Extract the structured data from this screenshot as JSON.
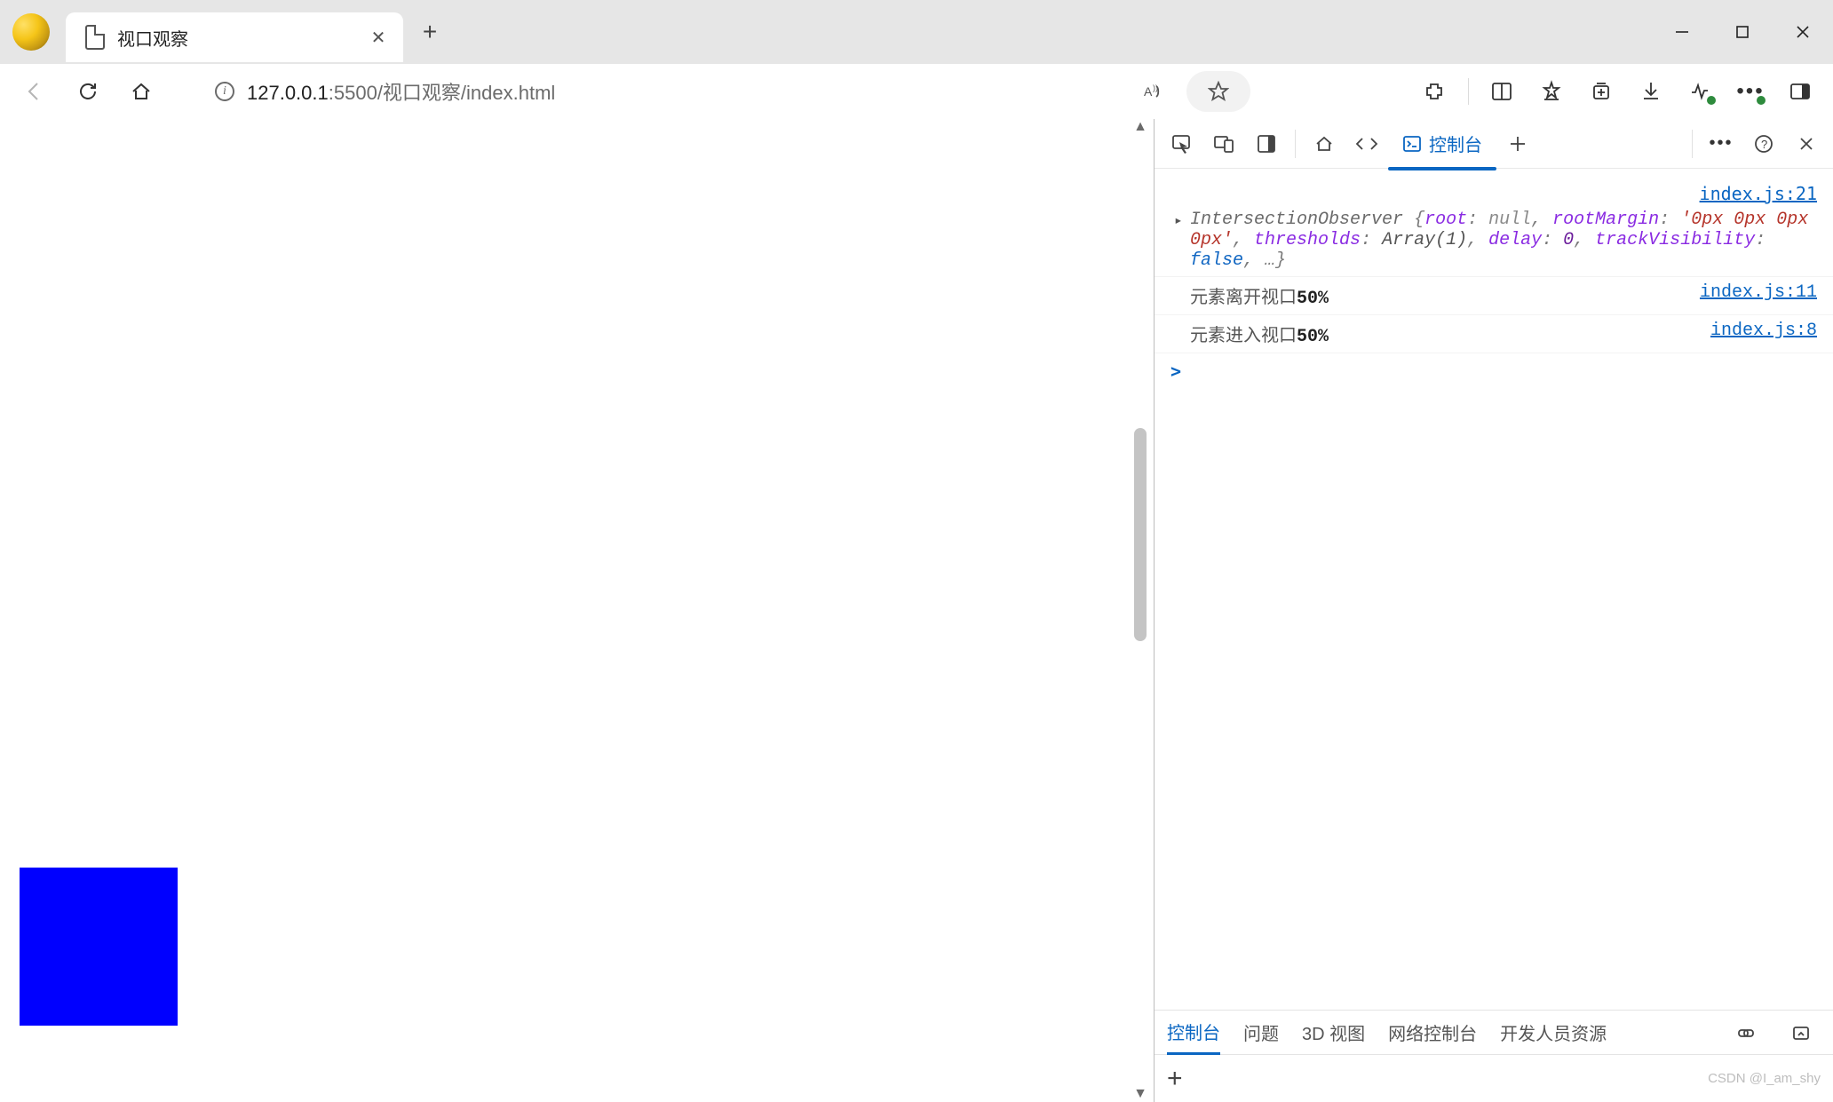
{
  "tab": {
    "title": "视口观察",
    "close": "✕",
    "newtab": "+"
  },
  "window": {
    "min": "—",
    "max": "☐",
    "close": "✕"
  },
  "addr": {
    "host": "127.0.0.1",
    "port": ":5500",
    "path": "/视口观察/index.html"
  },
  "devtools": {
    "tabs": {
      "console": "控制台"
    },
    "console": {
      "src1": "index.js:21",
      "obj": {
        "cls": "IntersectionObserver",
        "pairs": [
          {
            "k": "root",
            "type": "null",
            "v": "null"
          },
          {
            "k": "rootMargin",
            "type": "str",
            "v": "'0px 0px 0px 0px'"
          },
          {
            "k": "thresholds",
            "type": "arr",
            "v": "Array(1)"
          },
          {
            "k": "delay",
            "type": "num",
            "v": "0"
          },
          {
            "k": "trackVisibility",
            "type": "bool",
            "v": "false"
          }
        ],
        "ell": ", …}"
      },
      "line2": "元素离开视口",
      "line2b": "50%",
      "src2": "index.js:11",
      "line3": "元素进入视口",
      "line3b": "50%",
      "src3": "index.js:8"
    },
    "bottomTabs": [
      "控制台",
      "问题",
      "3D 视图",
      "网络控制台",
      "开发人员资源"
    ]
  },
  "watermark": "CSDN @I_am_shy"
}
